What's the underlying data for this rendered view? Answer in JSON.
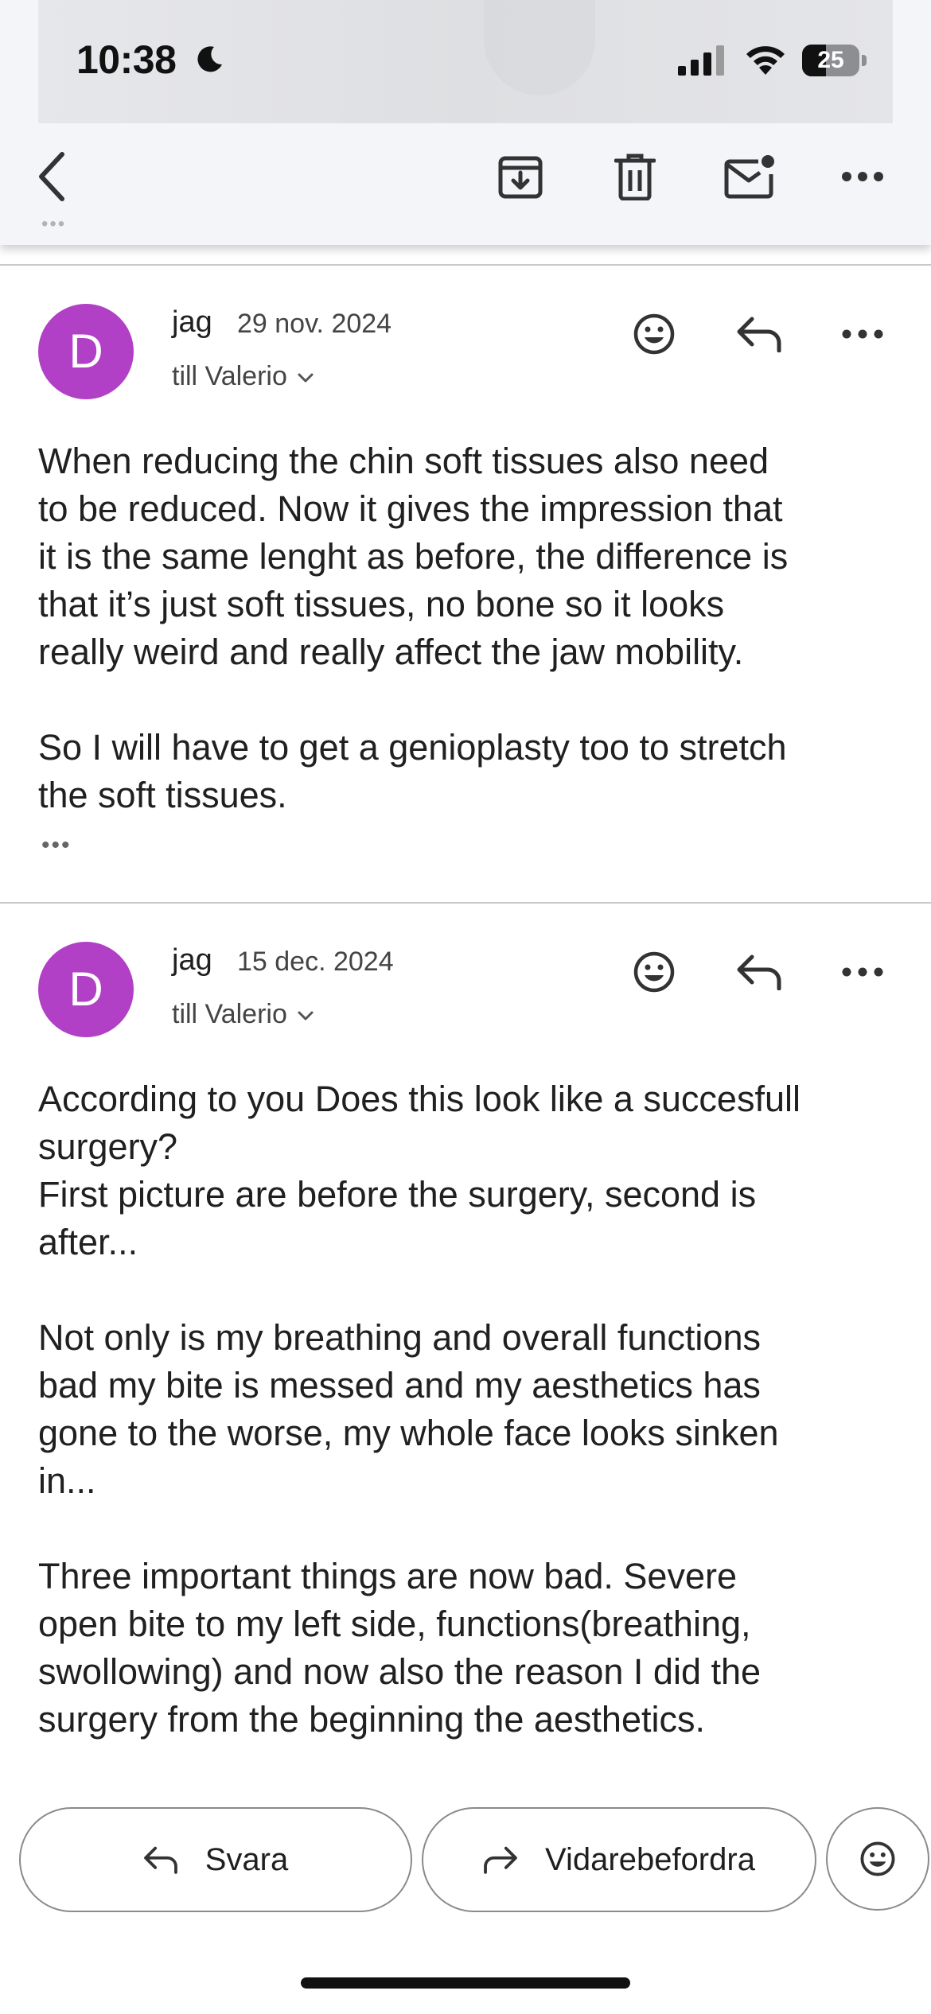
{
  "status_bar": {
    "time": "10:38",
    "battery_percent": "25",
    "icons": [
      "moon-icon",
      "signal-icon",
      "wifi-icon",
      "battery-icon"
    ]
  },
  "toolbar": {
    "icons": [
      "back-icon",
      "archive-icon",
      "delete-icon",
      "mark-unread-icon",
      "more-icon"
    ]
  },
  "messages": [
    {
      "avatar_letter": "D",
      "sender": "jag",
      "date": "29 nov. 2024",
      "recipient": "till Valerio",
      "paragraphs": [
        "When reducing the chin soft tissues also need\nto be reduced. Now it gives the impression that\nit is the same lenght as before, the difference is\nthat it’s just soft tissues, no bone so it looks\nreally weird and really affect the jaw mobility.",
        "So I will have to get a genioplasty too to stretch\nthe soft tissues."
      ]
    },
    {
      "avatar_letter": "D",
      "sender": "jag",
      "date": "15 dec. 2024",
      "recipient": "till Valerio",
      "paragraphs": [
        "According to you Does this look like a succesfull\nsurgery?\nFirst picture are before the surgery, second is\nafter...",
        "Not only is my breathing and overall functions\nbad my bite is messed and my aesthetics has\ngone to the worse, my whole face looks sinken\nin...",
        "Three important things are now bad. Severe\nopen bite to my left side, functions(breathing,\nswollowing) and now also the reason I did the\nsurgery from the beginning the aesthetics."
      ]
    }
  ],
  "actions": {
    "reply_label": "Svara",
    "forward_label": "Vidarebefordra"
  },
  "colors": {
    "avatar": "#b140c6",
    "header_bg": "#f3f5f9"
  }
}
